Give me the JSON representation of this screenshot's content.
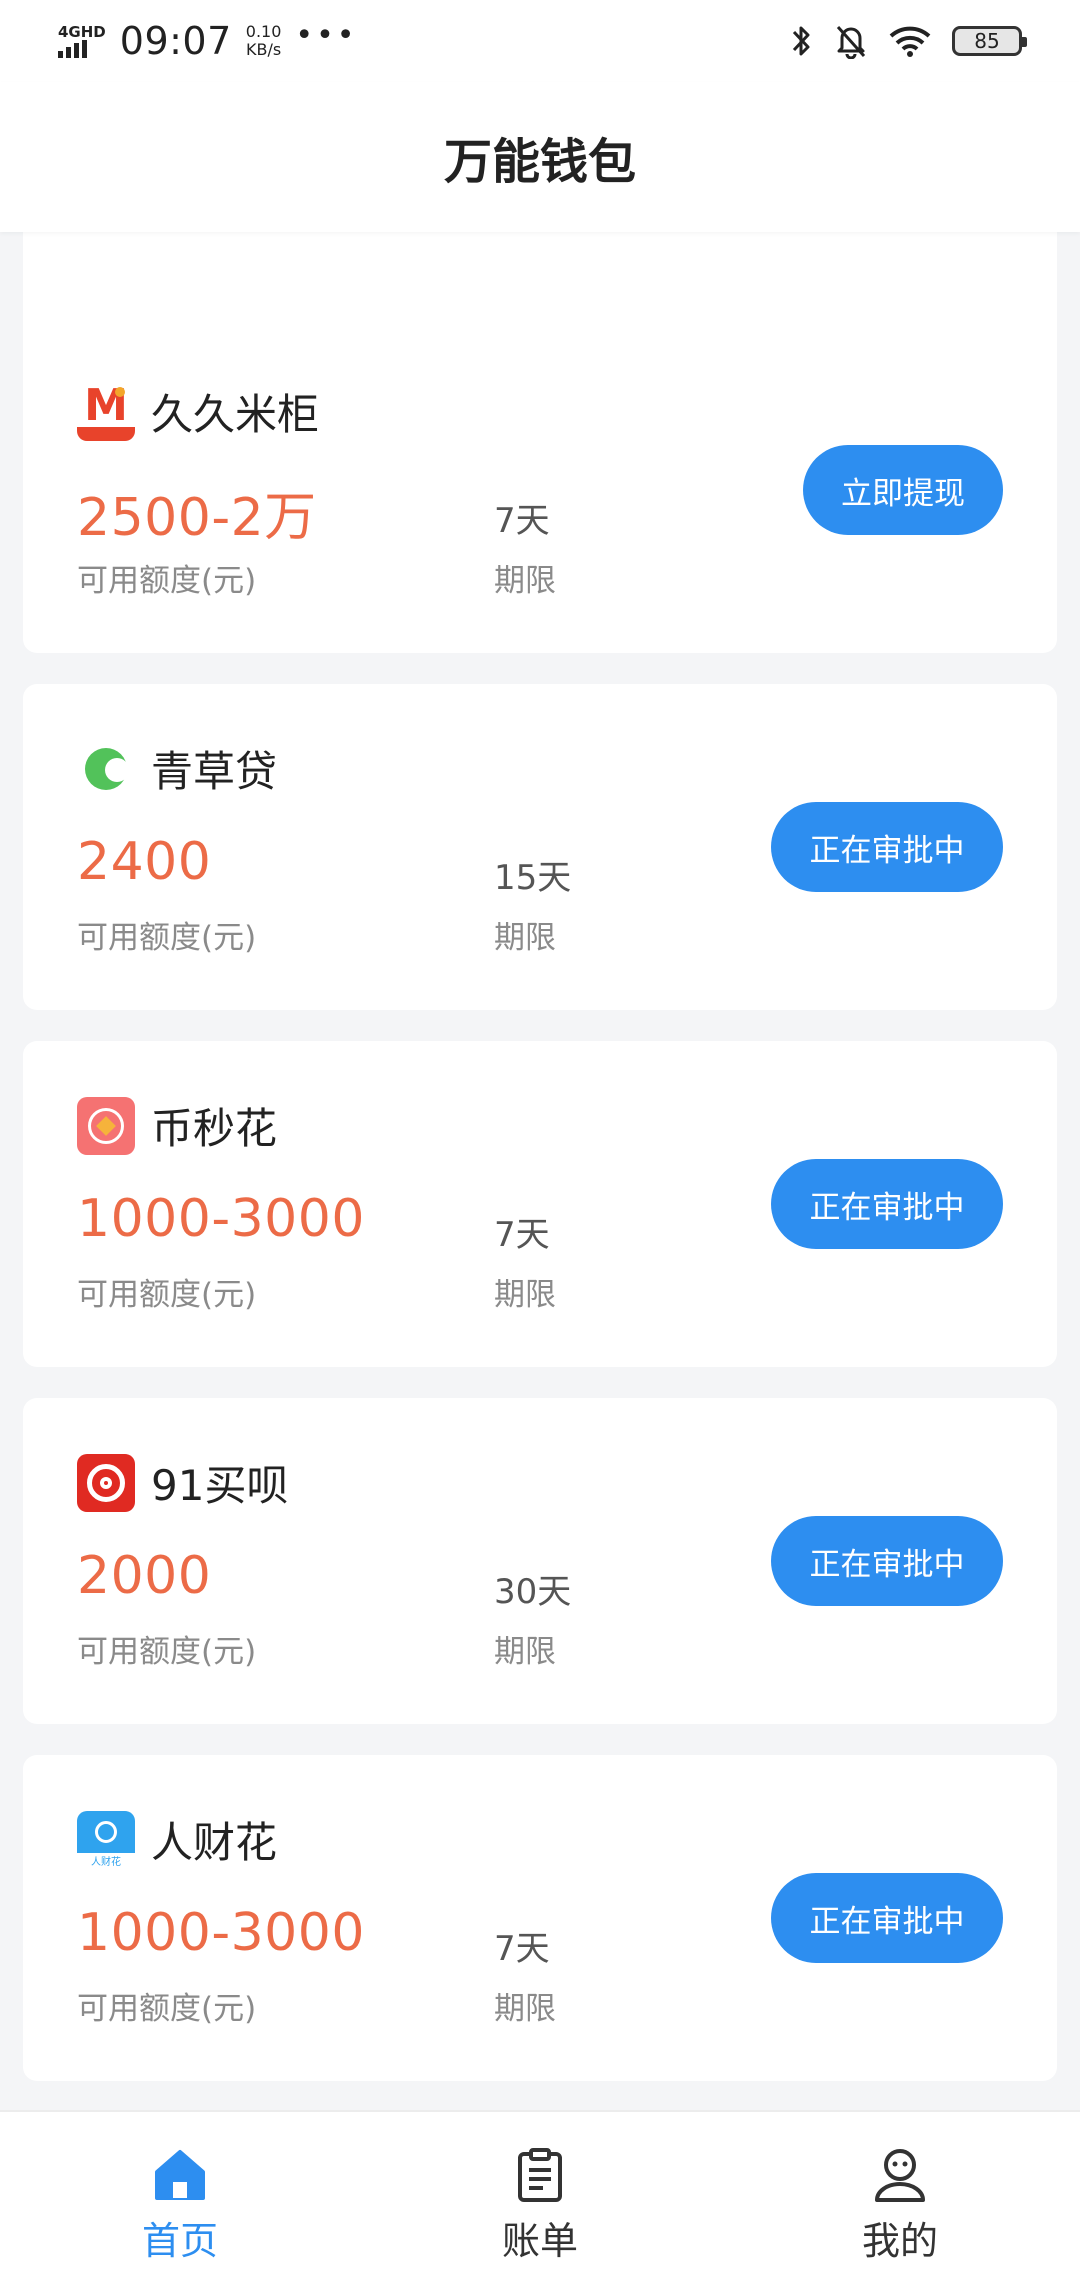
{
  "status_bar": {
    "network": "4GHD",
    "time": "09:07",
    "speed_value": "0.10",
    "speed_unit": "KB/s",
    "more": "•••",
    "battery": "85"
  },
  "header": {
    "title": "万能钱包"
  },
  "products": [
    {
      "name": "久久米柜",
      "logo_label": "久久米柜",
      "amount": "2500-2万",
      "amount_label": "可用额度(元)",
      "term": "7天",
      "term_label": "期限",
      "action": "立即提现"
    },
    {
      "name": "青草贷",
      "amount": "2400",
      "amount_label": "可用额度(元)",
      "term": "15天",
      "term_label": "期限",
      "action": "正在审批中"
    },
    {
      "name": "币秒花",
      "amount": "1000-3000",
      "amount_label": "可用额度(元)",
      "term": "7天",
      "term_label": "期限",
      "action": "正在审批中"
    },
    {
      "name": "91买呗",
      "amount": "2000",
      "amount_label": "可用额度(元)",
      "term": "30天",
      "term_label": "期限",
      "action": "正在审批中"
    },
    {
      "name": "人财花",
      "logo_label": "人财花",
      "amount": "1000-3000",
      "amount_label": "可用额度(元)",
      "term": "7天",
      "term_label": "期限",
      "action": "正在审批中"
    }
  ],
  "tabs": [
    {
      "label": "首页",
      "icon": "home-icon",
      "active": true
    },
    {
      "label": "账单",
      "icon": "clipboard-icon",
      "active": false
    },
    {
      "label": "我的",
      "icon": "user-icon",
      "active": false
    }
  ],
  "colors": {
    "accent": "#2d8ef0",
    "amount": "#ec6b47",
    "background": "#f4f5f7"
  }
}
